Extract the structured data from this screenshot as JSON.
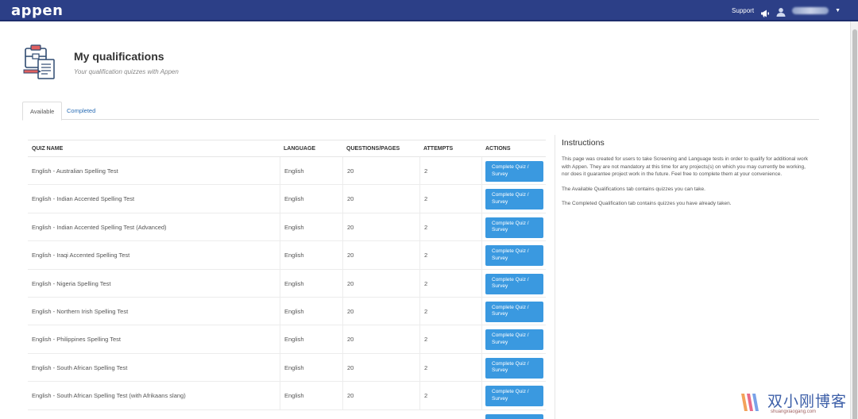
{
  "navbar": {
    "logo": "appen",
    "support_label": "Support",
    "icons": [
      "megaphone-icon",
      "user-icon",
      "chevron-down-icon"
    ],
    "bg_color": "#2c3f87"
  },
  "header": {
    "title": "My qualifications",
    "subtitle": "Your qualification quizzes with Appen"
  },
  "tabs": [
    {
      "label": "Available",
      "active": true
    },
    {
      "label": "Completed",
      "active": false
    }
  ],
  "table": {
    "columns": [
      "QUIZ NAME",
      "LANGUAGE",
      "QUESTIONS/PAGES",
      "ATTEMPTS",
      "ACTIONS"
    ],
    "action_label": "Complete Quiz / Survey",
    "rows": [
      {
        "name": "English - Australian Spelling Test",
        "language": "English",
        "questions": "20",
        "attempts": "2"
      },
      {
        "name": "English - Indian Accented Spelling Test",
        "language": "English",
        "questions": "20",
        "attempts": "2"
      },
      {
        "name": "English - Indian Accented Spelling Test (Advanced)",
        "language": "English",
        "questions": "20",
        "attempts": "2"
      },
      {
        "name": "English - Iraqi Accented Spelling Test",
        "language": "English",
        "questions": "20",
        "attempts": "2"
      },
      {
        "name": "English - Nigeria Spelling Test",
        "language": "English",
        "questions": "20",
        "attempts": "2"
      },
      {
        "name": "English - Northern Irish Spelling Test",
        "language": "English",
        "questions": "20",
        "attempts": "2"
      },
      {
        "name": "English - Philippines Spelling Test",
        "language": "English",
        "questions": "20",
        "attempts": "2"
      },
      {
        "name": "English - South African Spelling Test",
        "language": "English",
        "questions": "20",
        "attempts": "2"
      },
      {
        "name": "English - South African Spelling Test (with Afrikaans slang)",
        "language": "English",
        "questions": "20",
        "attempts": "2"
      }
    ]
  },
  "instructions": {
    "title": "Instructions",
    "paragraphs": [
      "This page was created for users to take Screening and Language tests in order to qualify for additional work with Appen. They are not mandatory at this time for any projects(s) on which you may currently be working, nor does it guarantee project work in the future. Feel free to complete them at your convenience.",
      "The Available Qualifications tab contains quizzes you can take.",
      "The Completed Qualification tab contains quizzes you have already taken."
    ]
  },
  "watermark": {
    "text": "双小刚博客",
    "sub": "shuangxiaogang.com"
  },
  "colors": {
    "accent_button": "#3a99e0",
    "link": "#2a6db5"
  }
}
